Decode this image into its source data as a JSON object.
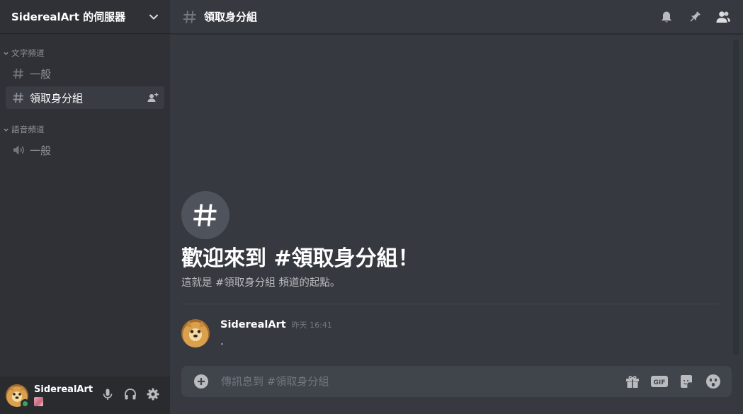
{
  "server": {
    "name": "SiderealArt 的伺服器"
  },
  "categories": [
    {
      "name": "文字頻道",
      "channels": [
        {
          "name": "一般",
          "type": "text"
        },
        {
          "name": "領取身分組",
          "type": "text",
          "active": true
        }
      ]
    },
    {
      "name": "語音頻道",
      "channels": [
        {
          "name": "一般",
          "type": "voice"
        }
      ]
    }
  ],
  "user": {
    "name": "SiderealArt",
    "status": "online"
  },
  "topbar": {
    "channel_name": "領取身分組"
  },
  "welcome": {
    "title": "歡迎來到 #領取身分組！",
    "subtitle": "這就是 #領取身分組 頻道的起點。"
  },
  "messages": [
    {
      "author": "SiderealArt",
      "timestamp": "昨天 16:41",
      "content": "."
    }
  ],
  "composer": {
    "placeholder": "傳訊息到 #領取身分組"
  },
  "colors": {
    "sidebar_bg": "#2f3136",
    "main_bg": "#36393f",
    "online": "#3ba55d"
  }
}
